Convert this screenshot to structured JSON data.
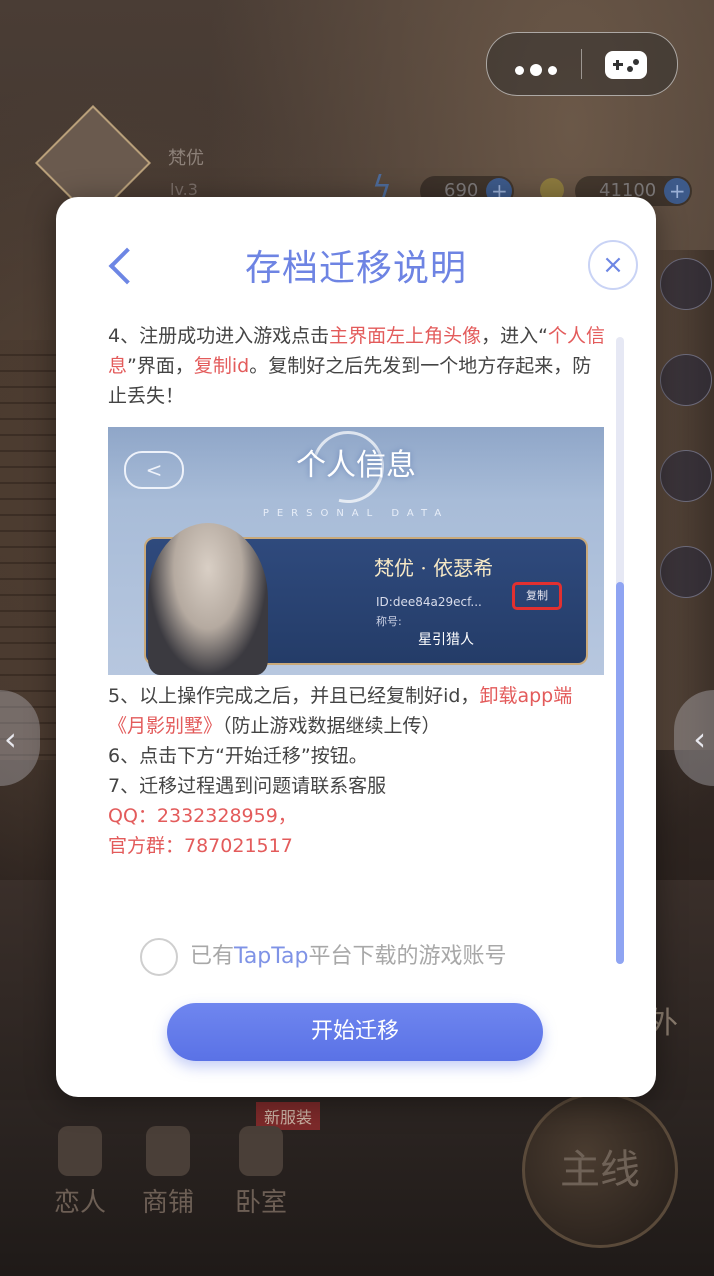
{
  "background": {
    "player_name": "梵优",
    "player_level": "lv.3",
    "currency_1": "690",
    "currency_2": "41100",
    "badge_new_outfit": "新服装",
    "nav": [
      "恋人",
      "商铺",
      "卧室"
    ],
    "main_quest": "主线",
    "outing": "外"
  },
  "capsule": {
    "more_icon": "more-dots-icon",
    "game_icon": "gamepad-icon"
  },
  "dialog": {
    "title": "存档迁移说明",
    "close_icon": "×",
    "step4": {
      "a": "4、注册成功进入游戏点击",
      "b": "主界面左上角头像",
      "c": "，进入“",
      "d": "个人信息",
      "e": "”界面，",
      "f": "复制id",
      "g": "。复制好之后先发到一个地方存起来，防止丢失！"
    },
    "screenshot": {
      "back": "<",
      "title": "个人信息",
      "subtitle": "PERSONAL DATA",
      "name": "梵优 · 依瑟希",
      "id": "ID:dee84a29ecf...",
      "copy": "复制",
      "nick_label": "称号:",
      "nick": "星引猎人"
    },
    "step5": {
      "a": "5、以上操作完成之后，并且已经复制好id，",
      "b": "卸载app端《月影别墅》",
      "c": "（防止游戏数据继续上传）"
    },
    "step6": "6、点击下方“开始迁移”按钮。",
    "step7": "7、迁移过程遇到问题请联系客服",
    "qq": "QQ：2332328959，",
    "group": "官方群：787021517",
    "agree": {
      "a": "已有",
      "b": "TapTap",
      "c": "平台下载的游戏账号"
    },
    "start_button": "开始迁移"
  },
  "colors": {
    "accent": "#6e84e3",
    "highlight": "#e35b5b",
    "button": "#5f77e8"
  }
}
